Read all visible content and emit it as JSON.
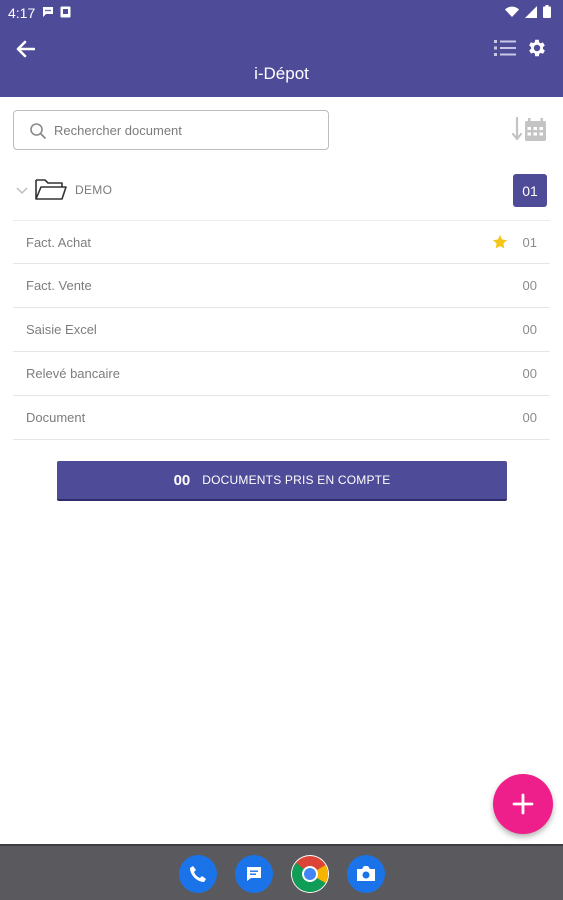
{
  "status_bar": {
    "time": "4:17"
  },
  "app_bar": {
    "title": "i-Dépot",
    "back_icon": "arrow-back-icon",
    "list_icon": "list-view-icon",
    "settings_icon": "gear-icon"
  },
  "search": {
    "placeholder": "Rechercher document",
    "value": ""
  },
  "folder": {
    "name": "DEMO",
    "count": "01",
    "expanded": true
  },
  "categories": [
    {
      "label": "Fact. Achat",
      "count": "01",
      "starred": true
    },
    {
      "label": "Fact. Vente",
      "count": "00",
      "starred": false
    },
    {
      "label": "Saisie Excel",
      "count": "00",
      "starred": false
    },
    {
      "label": "Relevé bancaire",
      "count": "00",
      "starred": false
    },
    {
      "label": "Document",
      "count": "00",
      "starred": false
    }
  ],
  "summary": {
    "count": "00",
    "label": "DOCUMENTS PRIS EN COMPTE"
  },
  "fab": {
    "icon": "plus-icon"
  },
  "dock": [
    "phone-icon",
    "messages-icon",
    "chrome-icon",
    "camera-icon"
  ],
  "colors": {
    "primary": "#4e4b98",
    "fab": "#ee1f8b",
    "star": "#f5c518",
    "nav_bar": "#5a5a5e"
  }
}
